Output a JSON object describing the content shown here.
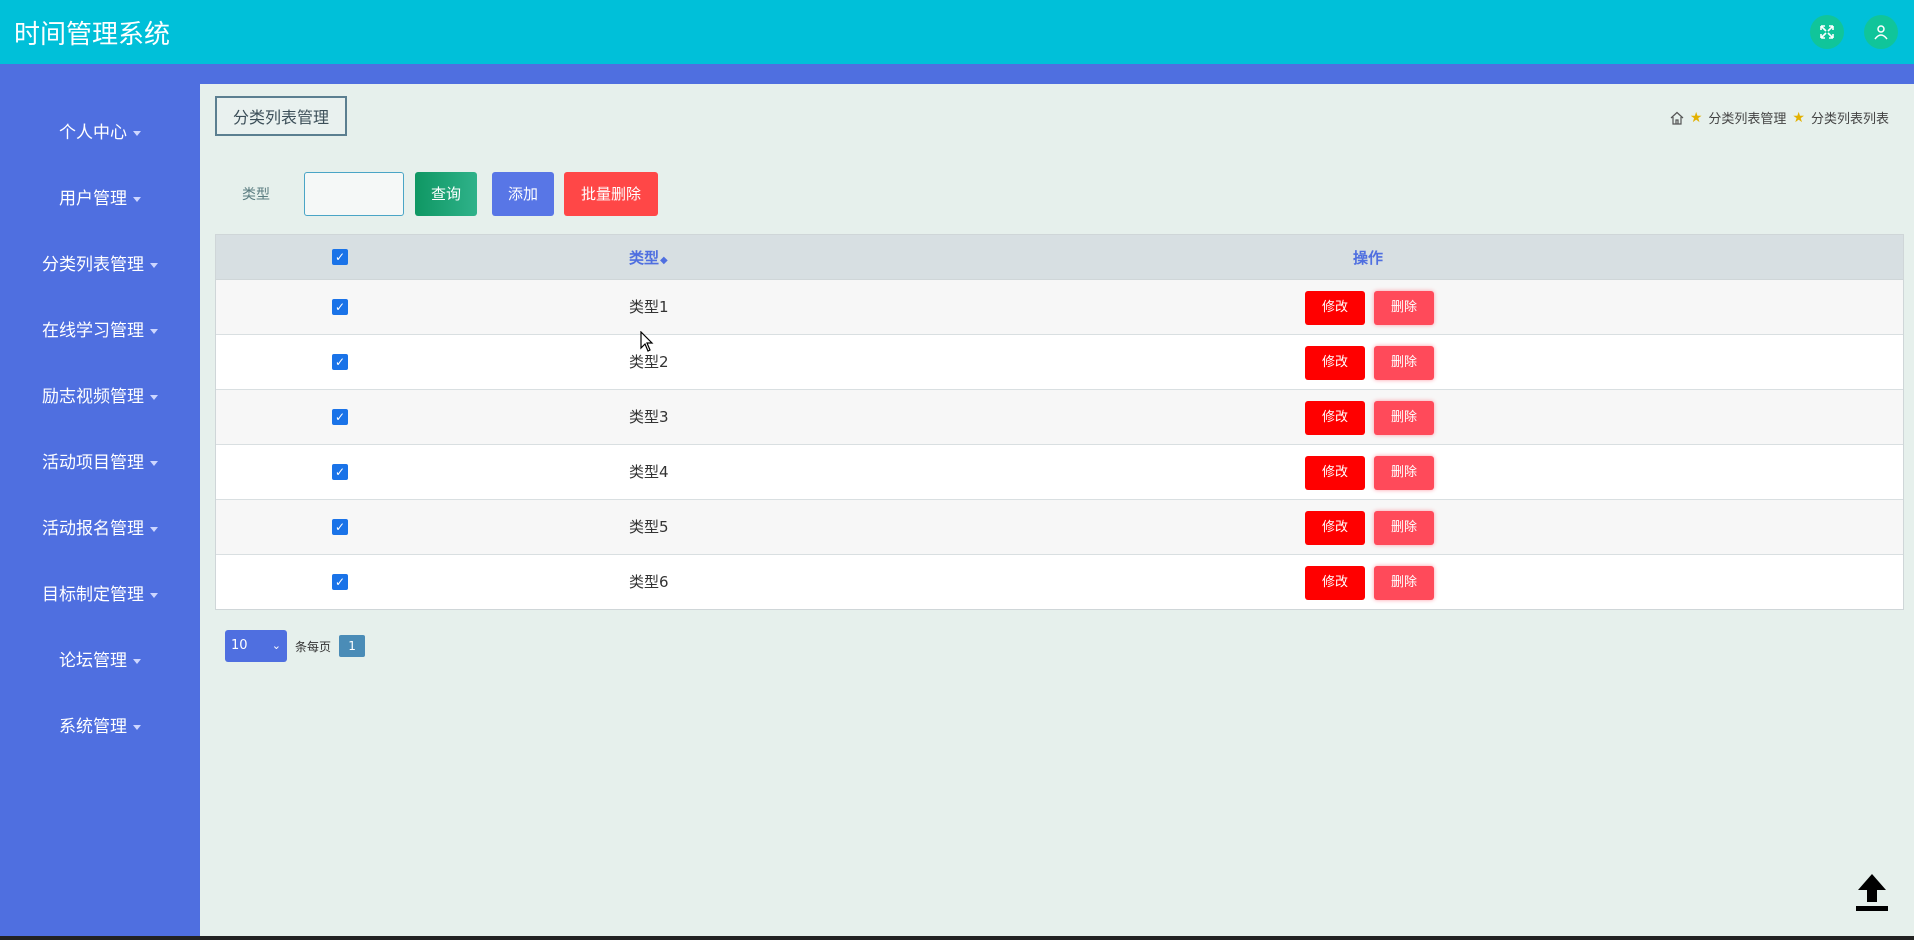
{
  "app": {
    "title": "时间管理系统"
  },
  "topbar": {
    "fullscreen_icon": "fullscreen-icon",
    "user_icon": "user-icon"
  },
  "sidebar": {
    "items": [
      {
        "label": "个人中心"
      },
      {
        "label": "用户管理"
      },
      {
        "label": "分类列表管理"
      },
      {
        "label": "在线学习管理"
      },
      {
        "label": "励志视频管理"
      },
      {
        "label": "活动项目管理"
      },
      {
        "label": "活动报名管理"
      },
      {
        "label": "目标制定管理"
      },
      {
        "label": "论坛管理"
      },
      {
        "label": "系统管理"
      }
    ]
  },
  "page": {
    "tab": "分类列表管理",
    "breadcrumb": [
      "分类列表管理",
      "分类列表列表"
    ]
  },
  "filter": {
    "label": "类型",
    "value": "",
    "query_button": "查询",
    "add_button": "添加",
    "batch_delete_button": "批量删除"
  },
  "table": {
    "headers": {
      "type": "类型",
      "actions": "操作"
    },
    "rows": [
      {
        "type": "类型1",
        "checked": true
      },
      {
        "type": "类型2",
        "checked": true
      },
      {
        "type": "类型3",
        "checked": true
      },
      {
        "type": "类型4",
        "checked": true
      },
      {
        "type": "类型5",
        "checked": true
      },
      {
        "type": "类型6",
        "checked": true
      }
    ],
    "edit_label": "修改",
    "delete_label": "删除"
  },
  "pagination": {
    "page_size": "10",
    "per_page_label": "条每页",
    "current_page": "1"
  },
  "colors": {
    "topbar": "#00c0d9",
    "sidebar": "#4f6fe0",
    "danger": "#ff0000"
  }
}
